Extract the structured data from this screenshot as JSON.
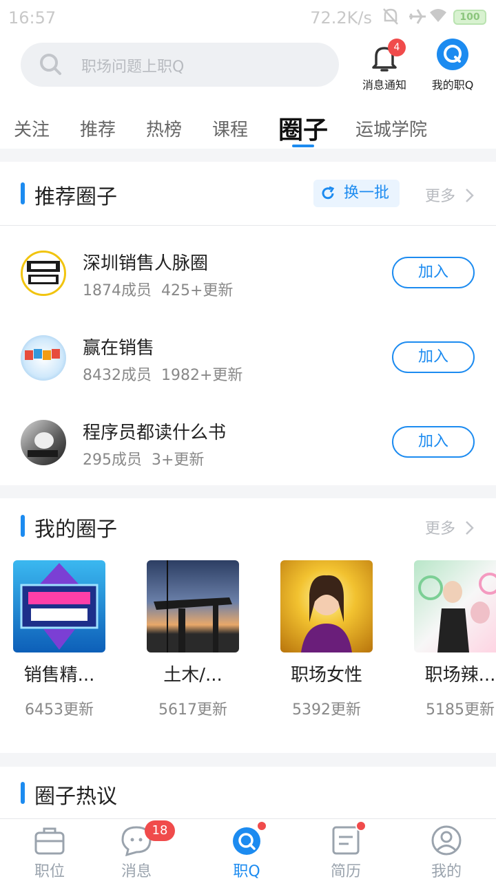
{
  "status_bar": {
    "time": "16:57",
    "net_speed": "72.2K/s",
    "battery": "100"
  },
  "header": {
    "search_placeholder": "职场问题上职Q",
    "notify_label": "消息通知",
    "notify_badge": "4",
    "myq_label": "我的职Q"
  },
  "tabs": [
    "关注",
    "推荐",
    "热榜",
    "课程",
    "圈子",
    "运城学院"
  ],
  "recommend": {
    "title": "推荐圈子",
    "refresh_label": "换一批",
    "more_label": "更多",
    "items": [
      {
        "name": "深圳销售人脉圈",
        "members": "1874成员",
        "updates": "425+更新",
        "action": "加入"
      },
      {
        "name": "赢在销售",
        "members": "8432成员",
        "updates": "1982+更新",
        "action": "加入"
      },
      {
        "name": "程序员都读什么书",
        "members": "295成员",
        "updates": "3+更新",
        "action": "加入"
      }
    ]
  },
  "my_circles": {
    "title": "我的圈子",
    "more_label": "更多",
    "items": [
      {
        "name": "销售精...",
        "updates": "6453更新"
      },
      {
        "name": "土木/...",
        "updates": "5617更新"
      },
      {
        "name": "职场女性",
        "updates": "5392更新"
      },
      {
        "name": "职场辣...",
        "updates": "5185更新"
      }
    ]
  },
  "hot": {
    "title": "圈子热议"
  },
  "bottom_nav": {
    "items": [
      "职位",
      "消息",
      "职Q",
      "简历",
      "我的"
    ],
    "message_badge": "18",
    "active": "职Q"
  },
  "colors": {
    "accent": "#1c8bf0",
    "badge": "#f04b4b"
  }
}
